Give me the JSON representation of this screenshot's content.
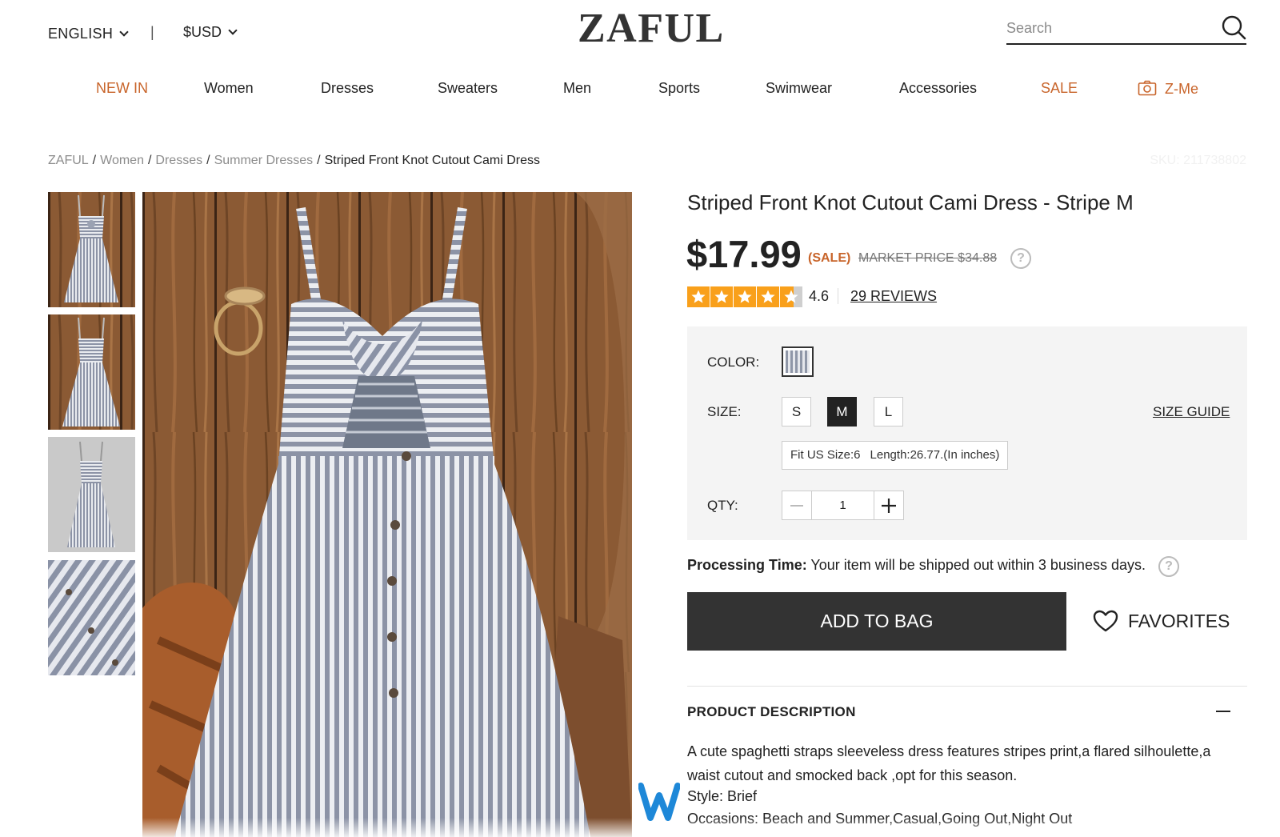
{
  "header": {
    "language": "ENGLISH",
    "separator": "|",
    "currency": "$USD",
    "logo": "ZAFUL",
    "search_placeholder": "Search"
  },
  "nav": {
    "items": [
      {
        "label": "NEW IN",
        "accent": true
      },
      {
        "label": "Women",
        "accent": false
      },
      {
        "label": "Dresses",
        "accent": false
      },
      {
        "label": "Sweaters",
        "accent": false
      },
      {
        "label": "Men",
        "accent": false
      },
      {
        "label": "Sports",
        "accent": false
      },
      {
        "label": "Swimwear",
        "accent": false
      },
      {
        "label": "Accessories",
        "accent": false
      },
      {
        "label": "SALE",
        "accent": true
      },
      {
        "label": "Z-Me",
        "accent": true
      }
    ]
  },
  "breadcrumb": {
    "items": [
      "ZAFUL",
      "Women",
      "Dresses",
      "Summer Dresses"
    ],
    "separator": "/",
    "current": "Striped Front Knot Cutout Cami Dress"
  },
  "sku": "SKU: 211738802",
  "product": {
    "title": "Striped Front Knot Cutout Cami Dress - Stripe M",
    "price": "$17.99",
    "sale_tag": "(SALE)",
    "market_price": "MARKET PRICE $34.88",
    "help_glyph": "?",
    "rating_value": 4.6,
    "rating_text": "4.6",
    "reviews_label": "29 REVIEWS"
  },
  "options": {
    "color_label": "COLOR:",
    "size_label": "SIZE:",
    "sizes": [
      "S",
      "M",
      "L"
    ],
    "selected_size": "M",
    "size_guide": "SIZE GUIDE",
    "fit_us": "Fit US Size:6",
    "fit_length": "Length:26.77.(In inches)",
    "qty_label": "QTY:",
    "qty_value": "1"
  },
  "processing": {
    "label": "Processing Time:",
    "text": " Your item will be shipped out within 3 business days."
  },
  "actions": {
    "add_to_bag": "ADD TO BAG",
    "favorites": "FAVORITES"
  },
  "description": {
    "title": "PRODUCT DESCRIPTION",
    "body": "A cute spaghetti straps sleeveless dress features stripes print,a flared silhoulette,a waist cutout and smocked back ,opt for this season.",
    "style": "Style: Brief",
    "occasions": "Occasions: Beach and Summer,Casual,Going Out,Night Out"
  },
  "colors": {
    "accent": "#c8642a",
    "dark_button": "#333333",
    "star": "#f9a01b",
    "options_bg": "#f4f4f4"
  },
  "icons": {
    "language_chevron": "chevron-down-icon",
    "search": "search-icon",
    "camera": "camera-icon",
    "help": "question-circle-icon",
    "star": "star-icon",
    "heart": "heart-icon",
    "minus": "minus-icon",
    "plus": "plus-icon",
    "collapse": "minus-icon",
    "widget": "w-logo-icon"
  }
}
